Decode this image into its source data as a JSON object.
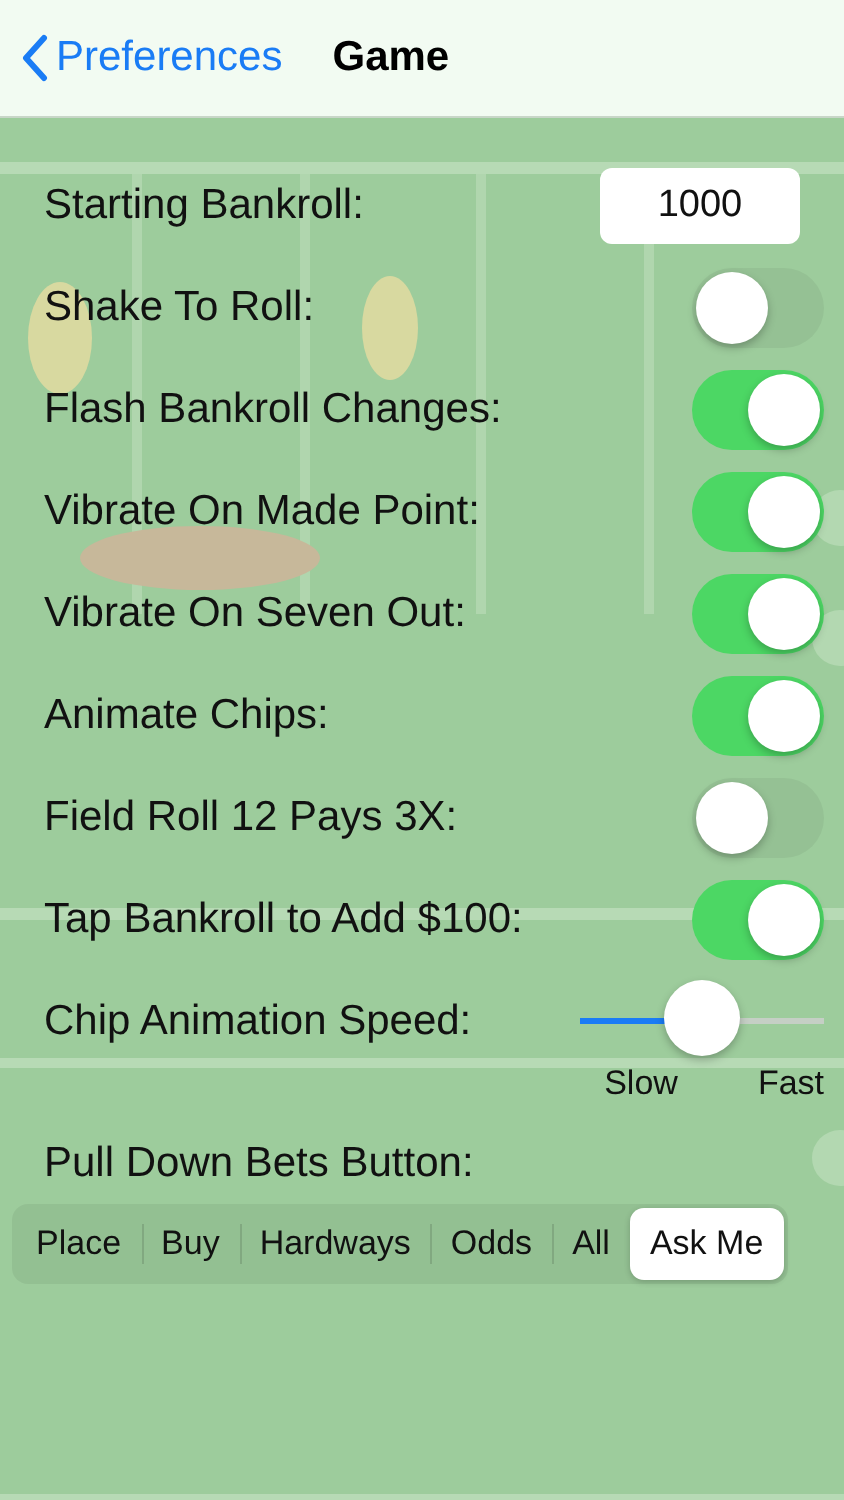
{
  "nav": {
    "back": "Preferences",
    "title": "Game"
  },
  "settings": [
    {
      "kind": "field",
      "label": "Starting Bankroll:",
      "value": "1000"
    },
    {
      "kind": "switch",
      "label": "Shake To Roll:",
      "on": false
    },
    {
      "kind": "switch",
      "label": "Flash Bankroll Changes:",
      "on": true
    },
    {
      "kind": "switch",
      "label": "Vibrate On Made Point:",
      "on": true
    },
    {
      "kind": "switch",
      "label": "Vibrate On Seven Out:",
      "on": true
    },
    {
      "kind": "switch",
      "label": "Animate Chips:",
      "on": true
    },
    {
      "kind": "switch",
      "label": "Field Roll 12 Pays 3X:",
      "on": false
    },
    {
      "kind": "switch",
      "label": "Tap Bankroll to Add $100:",
      "on": true
    },
    {
      "kind": "slider",
      "label": "Chip Animation Speed:",
      "level": 0.5,
      "min_label": "Slow",
      "max_label": "Fast"
    }
  ],
  "pull_down": {
    "label": "Pull Down Bets Button:",
    "options": [
      {
        "label": "Place",
        "selected": false
      },
      {
        "label": "Buy",
        "selected": false
      },
      {
        "label": "Hardways",
        "selected": false
      },
      {
        "label": "Odds",
        "selected": false
      },
      {
        "label": "All",
        "selected": false
      },
      {
        "label": "Ask Me",
        "selected": true
      }
    ]
  }
}
